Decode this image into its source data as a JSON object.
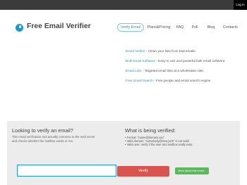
{
  "topbar": {
    "login_label": "Log in"
  },
  "brand": {
    "title": "Free Email Verifier"
  },
  "nav": {
    "items": [
      {
        "label": "Verify Email"
      },
      {
        "label": "Plans&Pricing"
      },
      {
        "label": "FAQ"
      },
      {
        "label": "Poll"
      },
      {
        "label": "Blog"
      },
      {
        "label": "Contacts"
      }
    ]
  },
  "features": [
    {
      "link": "Email Verifier",
      "text": " - Clean your lists from bad emails."
    },
    {
      "link": "Bulk Email Software",
      "text": " - Easy to use and powerful bulk email software."
    },
    {
      "link": "Email Lists",
      "text": " - Targeted email lists at a wholesales rate."
    },
    {
      "link": "Free Email Search",
      "text": " - Free people and email search engine"
    }
  ],
  "verify_panel": {
    "heading": "Looking to verify an email?",
    "description": "This email verification tool actually connects to the mail server and checks whether the mailbox exists or not.",
    "rules_heading": "What is being verified:",
    "rules": [
      "Format: \"name@domain.xxx\"",
      "Valid domain: \"somebody@new.york\" is not valid",
      "Valid user: verify if the user and mailbox really exist."
    ],
    "email_value": "",
    "verify_label": "Verify",
    "more_label": "More about this email..."
  }
}
